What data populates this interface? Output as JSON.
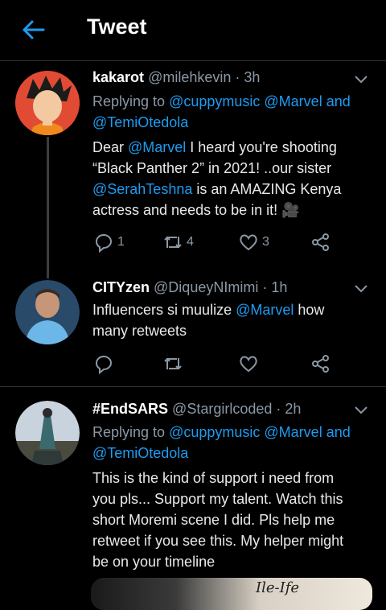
{
  "header": {
    "title": "Tweet"
  },
  "tweets": [
    {
      "name": "kakarot",
      "handle": "@milehkevin",
      "time": "· 3h",
      "reply_prefix": "Replying to",
      "reply_to_1": "@cuppymusic",
      "reply_to_2": "@Marvel",
      "reply_and": "and",
      "reply_to_3": "@TemiOtedola",
      "text": {
        "l1a": "Dear ",
        "l1b": "@Marvel",
        "l1c": " I heard you're shooting",
        "l2": "“Black Panther 2” in 2021! ..our sister",
        "l3a": "@SerahTeshna",
        "l3b": "  is an AMAZING Kenya",
        "l4": "actress and needs to be in it! 🎥"
      },
      "stats": {
        "replies": "1",
        "retweets": "4",
        "likes": "3"
      }
    },
    {
      "name": "CITYzen",
      "handle": "@DiqueyNImimi",
      "time": "· 1h",
      "text": {
        "l1a": "Influencers si muulize  ",
        "l1b": "@Marvel",
        "l1c": " how",
        "l2": "many retweets"
      }
    },
    {
      "name": "#EndSARS",
      "handle": "@Stargirlcoded",
      "time": "· 2h",
      "reply_prefix": "Replying to",
      "reply_to_1": "@cuppymusic",
      "reply_to_2": "@Marvel",
      "reply_and": "and",
      "reply_to_3": "@TemiOtedola",
      "text": {
        "l1": "This is the kind of support i need from",
        "l2": "you pls... Support my talent. Watch this",
        "l3": "short Moremi scene I did. Pls help me",
        "l4": "retweet if you see this. My helper might",
        "l5": "be on your timeline"
      },
      "media_caption": "Ile-Ife"
    }
  ],
  "colors": {
    "accent": "#1d9bf0",
    "muted": "#8b98a5",
    "background": "#000000"
  }
}
